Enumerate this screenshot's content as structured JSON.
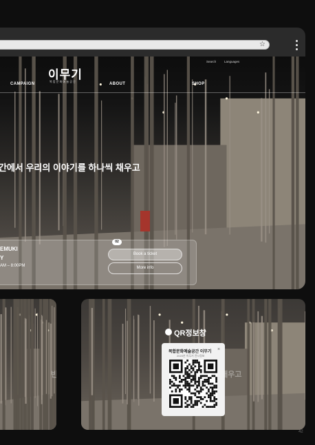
{
  "browser": {
    "star_icon": "star-icon",
    "menu_icon": "kebab-menu-icon"
  },
  "site": {
    "logo": "이무기",
    "logo_sub": "복합문화예술공간",
    "utility": {
      "search": "Search",
      "languages": "Languages"
    },
    "nav": [
      "CAMPAIGN",
      "ABOUT",
      "SHOP"
    ]
  },
  "hero": {
    "title": "공간에서 우리의 이야기를 하나씩 채우고"
  },
  "info": {
    "name": "EMUKI",
    "day": "Y",
    "time": "AM – 8:00PM",
    "step": "02",
    "book_label": "Book a ticket",
    "more_label": "More info"
  },
  "qr_section": {
    "title": "QR정보창",
    "faded_left": "빈 공간에",
    "faded_right": "씩 채우고",
    "popup_title": "복합문화예술공간 이무기",
    "popup_sub": "2024년 이무기 전시정보",
    "close_icon": "close-icon"
  },
  "page_number": "42",
  "colors": {
    "background": "#0e0e0e",
    "frame": "#2b2b2b",
    "accent": "#ffffff"
  }
}
